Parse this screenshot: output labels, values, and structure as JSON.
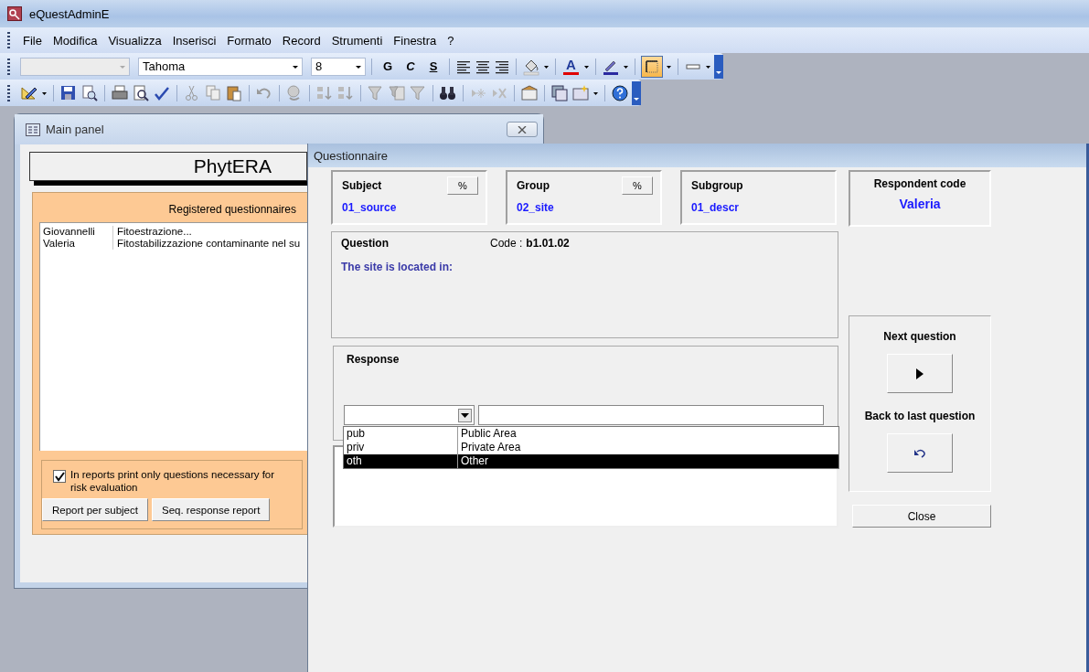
{
  "app_window": {
    "title": "eQuestAdminE"
  },
  "menu": [
    {
      "label": "File"
    },
    {
      "label": "Modifica"
    },
    {
      "label": "Visualizza"
    },
    {
      "label": "Inserisci"
    },
    {
      "label": "Formato"
    },
    {
      "label": "Record"
    },
    {
      "label": "Strumenti"
    },
    {
      "label": "Finestra"
    },
    {
      "label": "?"
    }
  ],
  "formatting_toolbar": {
    "font": "Tahoma",
    "size": "8",
    "style_buttons": [
      {
        "label": "G",
        "kind": "bold"
      },
      {
        "label": "C",
        "kind": "italic"
      },
      {
        "label": "S",
        "kind": "underline"
      }
    ],
    "font_color_label": "A",
    "border_pressed": true
  },
  "main_panel": {
    "title": "Main panel",
    "heading": "PhytERA",
    "list_title": "Registered questionnaires",
    "rows": [
      {
        "name": "Giovannelli",
        "title": "Fitoestrazione..."
      },
      {
        "name": "Valeria",
        "title": "Fitostabilizzazione contaminante nel su"
      }
    ],
    "print_option": {
      "label": "In reports print only questions necessary for risk evaluation",
      "checked": true
    },
    "buttons": [
      "Report per subject",
      "Seq. response report"
    ]
  },
  "questionnaire": {
    "title": "Questionnaire",
    "fields": [
      {
        "label": "Subject",
        "value": "01_source",
        "button": "%"
      },
      {
        "label": "Group",
        "value": "02_site",
        "button": "%"
      },
      {
        "label": "Subgroup",
        "value": "01_descr"
      }
    ],
    "respondent": {
      "label": "Respondent code",
      "value": "Valeria"
    },
    "question": {
      "label": "Question",
      "code_label": "Code :",
      "code": "b1.01.02",
      "text": "The site is located in:"
    },
    "response": {
      "label": "Response",
      "options": [
        {
          "code": "pub",
          "label": "Public Area",
          "selected": false
        },
        {
          "code": "priv",
          "label": "Private Area",
          "selected": false
        },
        {
          "code": "oth",
          "label": "Other",
          "selected": true
        }
      ]
    },
    "next_label": "Next question",
    "back_label": "Back to last question",
    "close": "Close"
  }
}
